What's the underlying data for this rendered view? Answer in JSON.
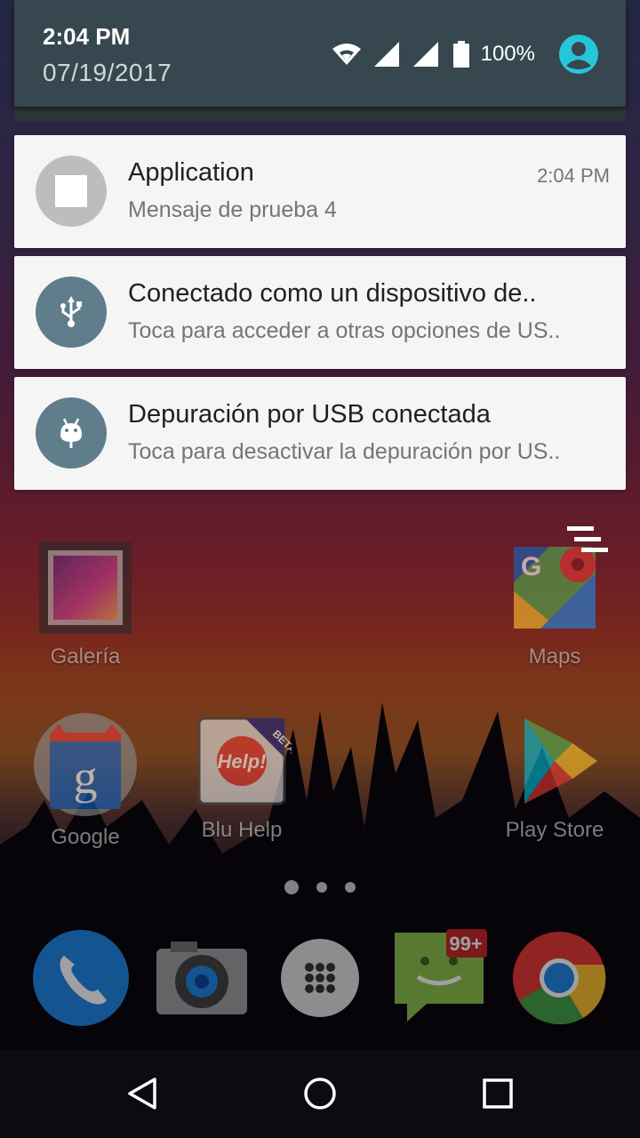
{
  "status": {
    "time": "2:04 PM",
    "date": "07/19/2017",
    "battery_pct": "100%",
    "icons": [
      "wifi-icon",
      "signal-icon",
      "signal-icon",
      "battery-icon",
      "user-avatar-icon"
    ]
  },
  "notifications": [
    {
      "title": "Application",
      "text": "Mensaje de prueba 4",
      "time": "2:04 PM",
      "icon": "app-icon",
      "icon_bg": "#bdbdbd"
    },
    {
      "title": "Conectado como un dispositivo de..",
      "text": "Toca para acceder a otras opciones de US..",
      "icon": "usb-icon",
      "icon_bg": "#607d8b"
    },
    {
      "title": "Depuración por USB conectada",
      "text": "Toca para desactivar la depuración por US..",
      "icon": "android-debug-icon",
      "icon_bg": "#607d8b"
    }
  ],
  "home": {
    "apps": [
      {
        "label": "Galería",
        "icon": "gallery-icon"
      },
      {
        "label": "Maps",
        "icon": "maps-icon"
      },
      {
        "label": "Google",
        "icon": "google-icon"
      },
      {
        "label": "Blu Help",
        "icon": "blu-help-icon",
        "badge": "BETA",
        "inner_text": "Help!"
      },
      {
        "label": "Play Store",
        "icon": "play-store-icon"
      }
    ],
    "page_dots": 3,
    "dock": [
      {
        "icon": "phone-icon"
      },
      {
        "icon": "camera-icon"
      },
      {
        "icon": "app-drawer-icon"
      },
      {
        "icon": "messages-icon",
        "badge": "99+"
      },
      {
        "icon": "chrome-icon"
      }
    ]
  },
  "navbar": {
    "buttons": [
      "back-icon",
      "home-icon",
      "recents-icon"
    ]
  },
  "colors": {
    "header": "#37474f",
    "notif_bg": "#f5f5f5",
    "accent": "#26c6da"
  }
}
